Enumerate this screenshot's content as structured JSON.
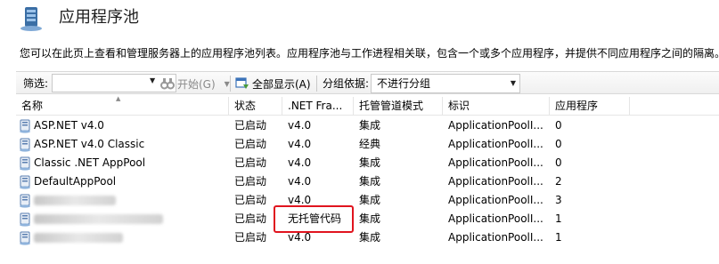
{
  "header": {
    "title": "应用程序池",
    "description": "您可以在此页上查看和管理服务器上的应用程序池列表。应用程序池与工作进程相关联，包含一个或多个应用程序，并提供不同应用程序之间的隔离。"
  },
  "toolbar": {
    "filter_label": "筛选:",
    "filter_value": "",
    "go_label": "开始(G)",
    "show_all_label": "全部显示(A)",
    "group_by_label": "分组依据:",
    "group_by_value": "不进行分组"
  },
  "grid": {
    "columns": [
      "名称",
      "状态",
      ".NET Fra...",
      "托管管道模式",
      "标识",
      "应用程序"
    ],
    "rows": [
      {
        "name": "ASP.NET v4.0",
        "status": "已启动",
        "netfx": "v4.0",
        "pipeline": "集成",
        "identity": "ApplicationPoolI...",
        "apps": "0"
      },
      {
        "name": "ASP.NET v4.0 Classic",
        "status": "已启动",
        "netfx": "v4.0",
        "pipeline": "经典",
        "identity": "ApplicationPoolI...",
        "apps": "0"
      },
      {
        "name": "Classic .NET AppPool",
        "status": "已启动",
        "netfx": "v4.0",
        "pipeline": "集成",
        "identity": "ApplicationPoolI...",
        "apps": "0"
      },
      {
        "name": "DefaultAppPool",
        "status": "已启动",
        "netfx": "v4.0",
        "pipeline": "集成",
        "identity": "ApplicationPoolI...",
        "apps": "2"
      },
      {
        "name": "",
        "status": "已启动",
        "netfx": "v4.0",
        "pipeline": "集成",
        "identity": "ApplicationPoolI...",
        "apps": "3"
      },
      {
        "name": "",
        "status": "已启动",
        "netfx": "无托管代码",
        "pipeline": "集成",
        "identity": "ApplicationPoolI...",
        "apps": "1"
      },
      {
        "name": "",
        "status": "已启动",
        "netfx": "v4.0",
        "pipeline": "集成",
        "identity": "ApplicationPoolI...",
        "apps": "1"
      }
    ]
  },
  "colors": {
    "highlight": "#e0141e",
    "grid_line": "#e5e5e5",
    "disabled_text": "#8a8a8a"
  }
}
